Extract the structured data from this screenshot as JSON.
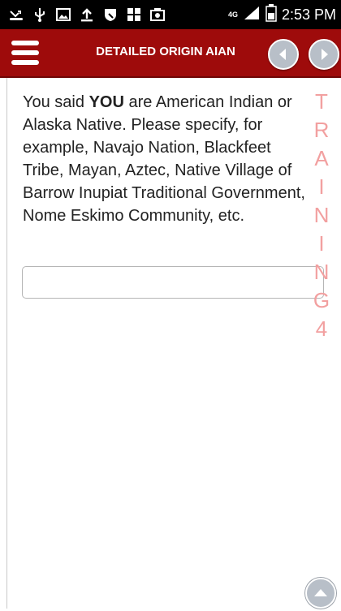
{
  "status_bar": {
    "icons": [
      "missed-call-icon",
      "usb-icon",
      "image-icon",
      "upload-icon",
      "shield-icon",
      "apps-icon",
      "camera-icon"
    ],
    "network": "4G",
    "time": "2:53 PM"
  },
  "header": {
    "title": "DETAILED ORIGIN AIAN",
    "menu_icon": "hamburger-menu-icon",
    "back_icon": "chevron-left-icon",
    "forward_icon": "chevron-right-icon"
  },
  "question": {
    "pre": "You said ",
    "emphasis": "YOU",
    "post": " are American Indian or Alaska Native. Please specify, for example, Navajo Nation, Blackfeet Tribe, Mayan, Aztec, Native Village of Barrow Inupiat Traditional Government, Nome Eskimo Community, etc."
  },
  "answer": {
    "value": "",
    "placeholder": ""
  },
  "watermark": [
    "T",
    "R",
    "A",
    "I",
    "N",
    "I",
    "N",
    "G",
    "4"
  ],
  "scroll_up_icon": "chevron-up-icon",
  "colors": {
    "header_bg": "#9e0b0b",
    "nav_button": "#b8bfc8",
    "watermark": "#f2a0a0"
  }
}
